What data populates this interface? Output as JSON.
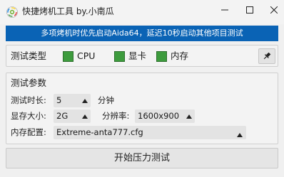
{
  "window": {
    "title": "快捷烤机工具 by.小南瓜",
    "icon": "colorful-circle-app-icon"
  },
  "banner": {
    "text": "多项烤机时优先启动Aida64，延迟10秒启动其他项目测试",
    "color": "#0a63b5"
  },
  "test_type": {
    "label": "测试类型",
    "options": [
      {
        "label": "CPU",
        "checked": true
      },
      {
        "label": "显卡",
        "checked": true
      },
      {
        "label": "内存",
        "checked": true
      }
    ],
    "check_color": "#3d9b3d",
    "pin_icon": "pin-icon"
  },
  "params": {
    "title": "测试参数",
    "duration_label": "测试时长:",
    "duration_value": "5",
    "duration_unit": "分钟",
    "vram_label": "显存大小:",
    "vram_value": "2G",
    "resolution_label": "分辨率:",
    "resolution_value": "1600x900",
    "mem_config_label": "内存配置:",
    "mem_config_value": "Extreme-anta777.cfg"
  },
  "start_button": {
    "label": "开始压力测试"
  }
}
